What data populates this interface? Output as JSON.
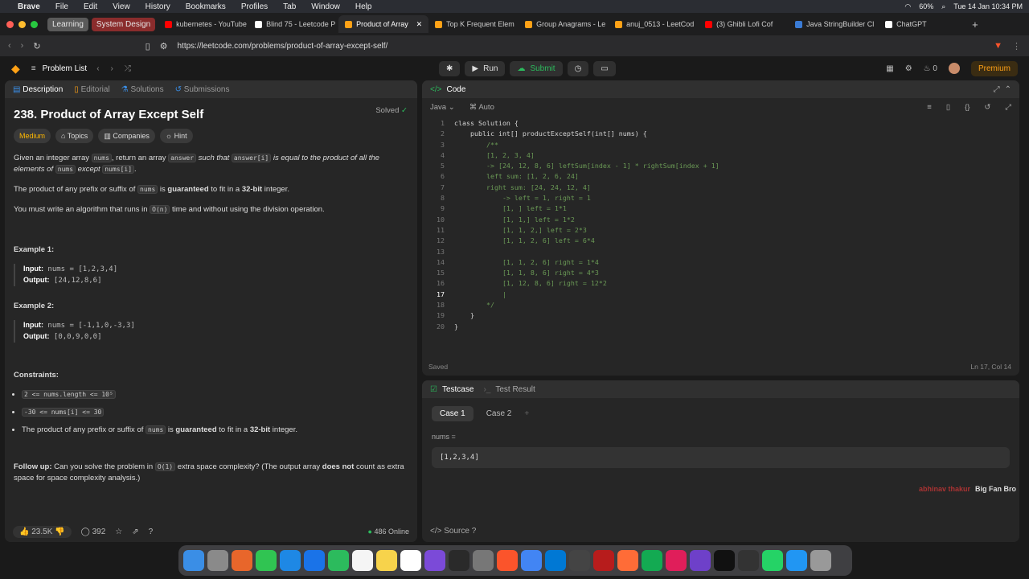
{
  "menubar": {
    "app": "Brave",
    "items": [
      "File",
      "Edit",
      "View",
      "History",
      "Bookmarks",
      "Profiles",
      "Tab",
      "Window",
      "Help"
    ],
    "battery": "60%",
    "datetime": "Tue 14 Jan  10:34 PM"
  },
  "tabs": {
    "groups": [
      {
        "label": "Learning",
        "color": "#5a5a5a"
      },
      {
        "label": "System Design",
        "color": "#8a2c2c"
      }
    ],
    "items": [
      {
        "label": "kubernetes - YouTube",
        "color": "#ff0000"
      },
      {
        "label": "Blind 75 - Leetcode P",
        "color": "#ffffff"
      },
      {
        "label": "Product of Array",
        "color": "#ffa116",
        "active": true
      },
      {
        "label": "Top K Frequent Elem",
        "color": "#ffa116"
      },
      {
        "label": "Group Anagrams - Le",
        "color": "#ffa116"
      },
      {
        "label": "anuj_0513 - LeetCod",
        "color": "#ffa116"
      },
      {
        "label": "(3) Ghibli Lofi Cof",
        "color": "#ff0000"
      },
      {
        "label": "Java StringBuilder Cl",
        "color": "#3a7bd5"
      },
      {
        "label": "ChatGPT",
        "color": "#ffffff"
      }
    ]
  },
  "address": {
    "url": "https://leetcode.com/problems/product-of-array-except-self/"
  },
  "lcbar": {
    "problem_list": "Problem List",
    "run": "Run",
    "submit": "Submit",
    "streak": "0",
    "premium": "Premium"
  },
  "left": {
    "tabs": [
      "Description",
      "Editorial",
      "Solutions",
      "Submissions"
    ],
    "title": "238. Product of Array Except Self",
    "solved": "Solved",
    "tags": [
      "Medium",
      "Topics",
      "Companies",
      "Hint"
    ],
    "p1a": "Given an integer array ",
    "p1code1": "nums",
    "p1b": ", return an array ",
    "p1code2": "answer",
    "p1c": " such that ",
    "p1code3": "answer[i]",
    "p1d": " is equal to the product of all the elements of ",
    "p1code4": "nums",
    "p1e": " except ",
    "p1code5": "nums[i]",
    "p1f": ".",
    "p2a": "The product of any prefix or suffix of ",
    "p2code": "nums",
    "p2b": " is ",
    "p2bold1": "guaranteed",
    "p2c": " to fit in a ",
    "p2bold2": "32-bit",
    "p2d": " integer.",
    "p3a": "You must write an algorithm that runs in ",
    "p3code": "O(n)",
    "p3b": " time and without using the division operation.",
    "ex1_title": "Example 1:",
    "ex1_in_label": "Input:",
    "ex1_in": "nums = [1,2,3,4]",
    "ex1_out_label": "Output:",
    "ex1_out": "[24,12,8,6]",
    "ex2_title": "Example 2:",
    "ex2_in_label": "Input:",
    "ex2_in": "nums = [-1,1,0,-3,3]",
    "ex2_out_label": "Output:",
    "ex2_out": "[0,0,9,0,0]",
    "cons_title": "Constraints:",
    "cons1": "2 <= nums.length <= 10⁵",
    "cons2": "-30 <= nums[i] <= 30",
    "cons3a": "The product of any prefix or suffix of ",
    "cons3code": "nums",
    "cons3b": " is ",
    "cons3bold1": "guaranteed",
    "cons3c": " to fit in a ",
    "cons3bold2": "32-bit",
    "cons3d": " integer.",
    "follow_label": "Follow up:",
    "follow_a": " Can you solve the problem in ",
    "follow_code": "O(1)",
    "follow_b": " extra space complexity? (The output array ",
    "follow_bold": "does not",
    "follow_c": " count as extra space for space complexity analysis.)",
    "likes": "23.5K",
    "comments": "392",
    "online": "486 Online"
  },
  "code": {
    "title": "Code",
    "lang": "Java",
    "auto": "Auto",
    "lines": [
      "class Solution {",
      "    public int[] productExceptSelf(int[] nums) {",
      "        /**",
      "        [1, 2, 3, 4]",
      "        -> [24, 12, 8, 6] leftSum[index - 1] * rightSum[index + 1]",
      "        left sum: [1, 2, 6, 24]",
      "        right sum: [24, 24, 12, 4]",
      "            -> left = 1, right = 1",
      "            [1, ] left = 1*1",
      "            [1, 1,] left = 1*2",
      "            [1, 1, 2,] left = 2*3",
      "            [1, 1, 2, 6] left = 6*4",
      "",
      "            [1, 1, 2, 6] right = 1*4",
      "            [1, 1, 8, 6] right = 4*3",
      "            [1, 12, 8, 6] right = 12*2",
      "            |",
      "        */",
      "    }",
      "}"
    ],
    "saved": "Saved",
    "position": "Ln 17, Col 14"
  },
  "test": {
    "tabs": [
      "Testcase",
      "Test Result"
    ],
    "cases": [
      "Case 1",
      "Case 2"
    ],
    "var_label": "nums =",
    "var_value": "[1,2,3,4]",
    "source": "Source",
    "watermark_name": "abhinav thakur",
    "watermark_text": "Big Fan Bro"
  }
}
